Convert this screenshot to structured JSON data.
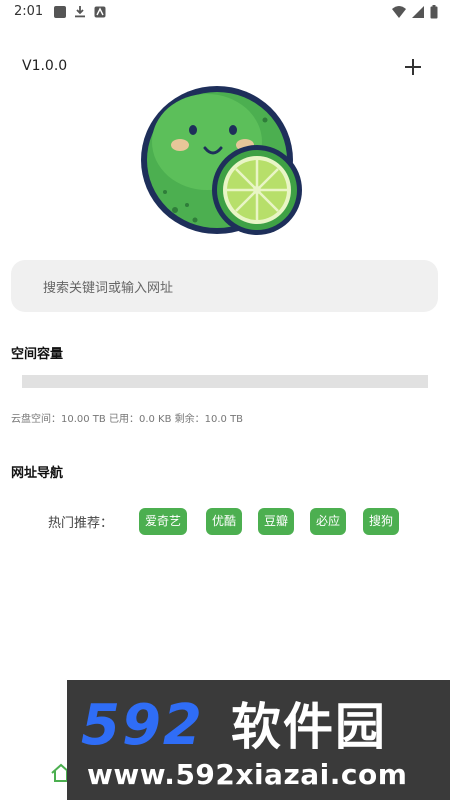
{
  "status_bar": {
    "time": "2:01"
  },
  "header": {
    "version": "V1.0.0"
  },
  "search": {
    "placeholder": "搜索关键词或输入网址"
  },
  "storage": {
    "title": "空间容量",
    "info": "云盘空间：10.00 TB 已用：0.0 KB 剩余：10.0 TB",
    "used_fraction": 0
  },
  "nav": {
    "title": "网址导航",
    "hot_label": "热门推荐：",
    "sites": [
      "爱奇艺",
      "优酷",
      "豆瓣",
      "必应",
      "搜狗"
    ]
  },
  "watermark": {
    "brand": "592软件园",
    "url": "www.592xiazai.com"
  },
  "colors": {
    "accent": "#4caf50",
    "search_bg": "#f0f0f0",
    "bar_bg": "#e1e1e1",
    "watermark_bg": "#3a3a3a",
    "watermark_blue": "#2f6df6"
  }
}
